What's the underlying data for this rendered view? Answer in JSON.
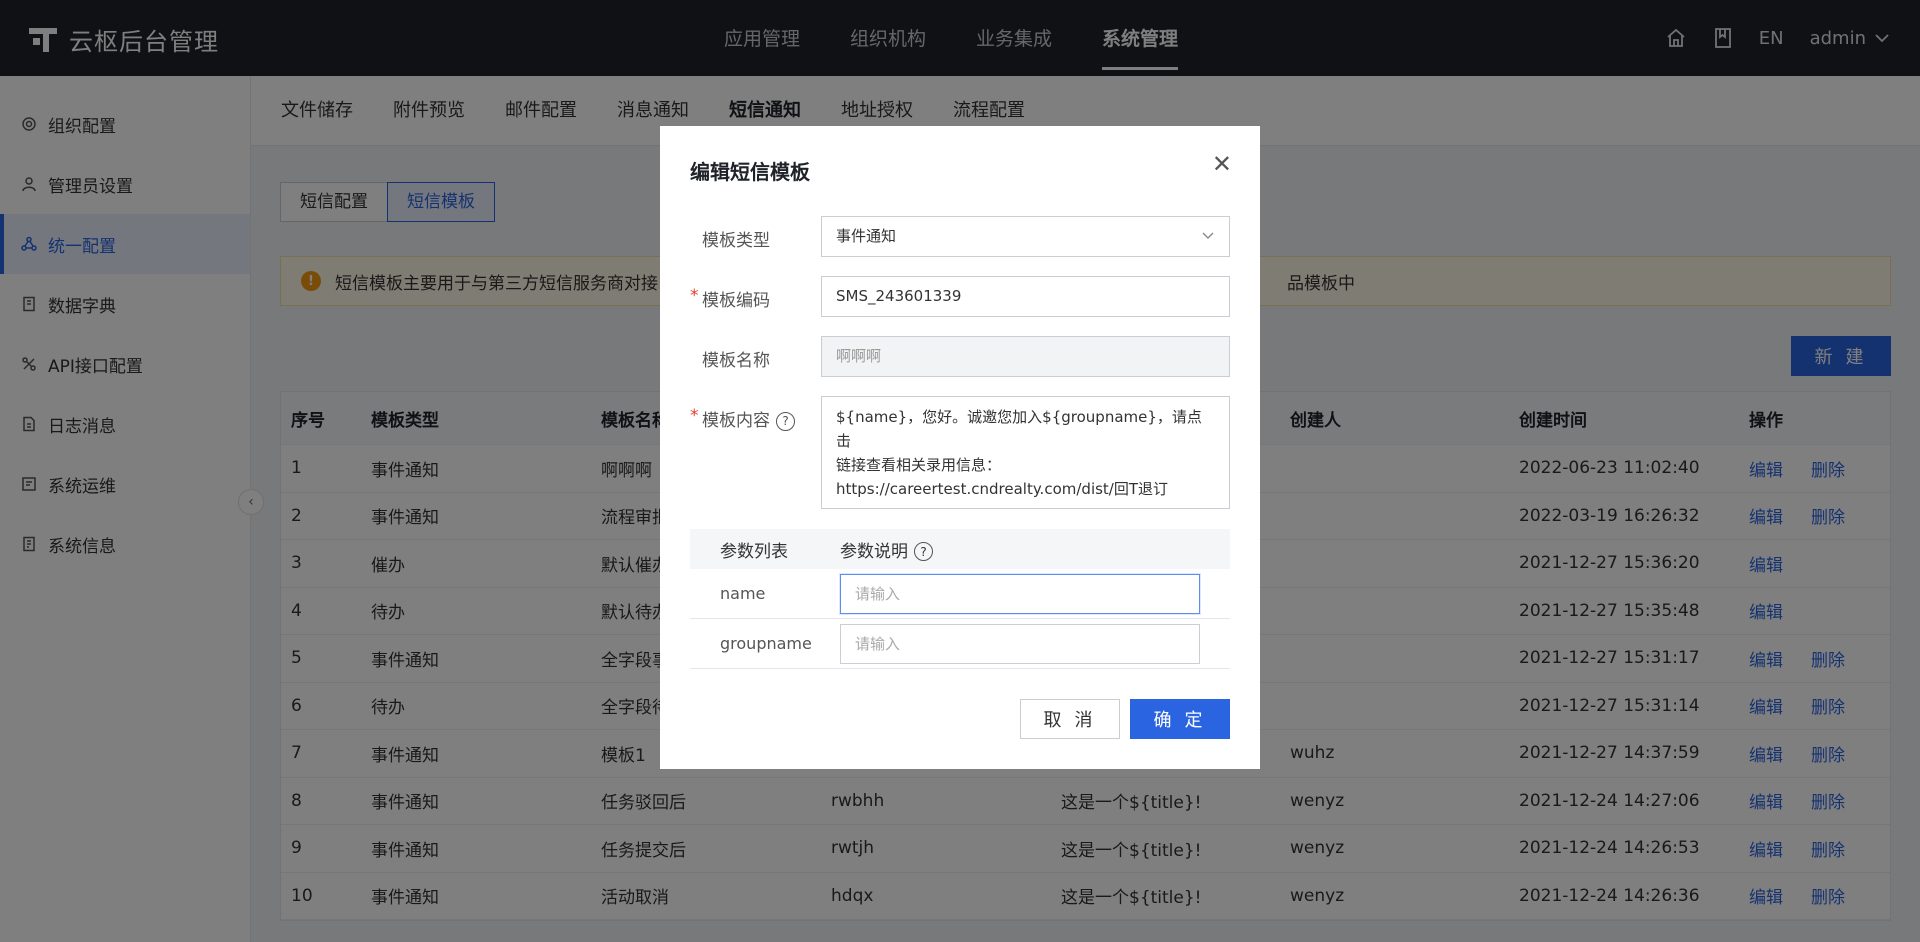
{
  "app": {
    "title": "云枢后台管理"
  },
  "topnav": [
    {
      "label": "应用管理"
    },
    {
      "label": "组织机构"
    },
    {
      "label": "业务集成"
    },
    {
      "label": "系统管理"
    }
  ],
  "topright": {
    "lang": "EN",
    "user": "admin"
  },
  "sidebar": [
    {
      "label": "组织配置",
      "icon": "gear-icon"
    },
    {
      "label": "管理员设置",
      "icon": "user-icon"
    },
    {
      "label": "统一配置",
      "icon": "share-icon"
    },
    {
      "label": "数据字典",
      "icon": "book-icon"
    },
    {
      "label": "API接口配置",
      "icon": "api-icon"
    },
    {
      "label": "日志消息",
      "icon": "document-icon"
    },
    {
      "label": "系统运维",
      "icon": "monitor-icon"
    },
    {
      "label": "系统信息",
      "icon": "info-document-icon"
    }
  ],
  "subtabs": [
    {
      "label": "文件储存"
    },
    {
      "label": "附件预览"
    },
    {
      "label": "邮件配置"
    },
    {
      "label": "消息通知"
    },
    {
      "label": "短信通知"
    },
    {
      "label": "地址授权"
    },
    {
      "label": "流程配置"
    }
  ],
  "segment": {
    "config": "短信配置",
    "template": "短信模板"
  },
  "notice": {
    "text": "短信模板主要用于与第三方短信服务商对接",
    "tail": "品模板中"
  },
  "new_button": "新 建",
  "table": {
    "headers": [
      "序号",
      "模板类型",
      "模板名称",
      "",
      "",
      "创建人",
      "创建时间",
      "操作"
    ],
    "edit_label": "编辑",
    "delete_label": "删除",
    "rows": [
      {
        "no": "1",
        "type": "事件通知",
        "name": "啊啊啊",
        "code": "",
        "content": "",
        "creator": "",
        "time": "2022-06-23 11:02:40",
        "del": "删除"
      },
      {
        "no": "2",
        "type": "事件通知",
        "name": "流程审批",
        "code": "",
        "content": "",
        "creator": "",
        "time": "2022-03-19 16:26:32",
        "del": "删除"
      },
      {
        "no": "3",
        "type": "催办",
        "name": "默认催办",
        "code": "",
        "content": "",
        "creator": "",
        "time": "2021-12-27 15:36:20",
        "del": ""
      },
      {
        "no": "4",
        "type": "待办",
        "name": "默认待办",
        "code": "",
        "content": "",
        "creator": "",
        "time": "2021-12-27 15:35:48",
        "del": ""
      },
      {
        "no": "5",
        "type": "事件通知",
        "name": "全字段事",
        "code": "",
        "content": "",
        "creator": "",
        "time": "2021-12-27 15:31:17",
        "del": "删除"
      },
      {
        "no": "6",
        "type": "待办",
        "name": "全字段待",
        "code": "",
        "content": "",
        "creator": "",
        "time": "2021-12-27 15:31:14",
        "del": "删除"
      },
      {
        "no": "7",
        "type": "事件通知",
        "name": "模板1",
        "code": "",
        "content": "",
        "creator": "wuhz",
        "time": "2021-12-27 14:37:59",
        "del": "删除"
      },
      {
        "no": "8",
        "type": "事件通知",
        "name": "任务驳回后",
        "code": "rwbhh",
        "content": "这是一个${title}!",
        "creator": "wenyz",
        "time": "2021-12-24 14:27:06",
        "del": "删除"
      },
      {
        "no": "9",
        "type": "事件通知",
        "name": "任务提交后",
        "code": "rwtjh",
        "content": "这是一个${title}!",
        "creator": "wenyz",
        "time": "2021-12-24 14:26:53",
        "del": "删除"
      },
      {
        "no": "10",
        "type": "事件通知",
        "name": "活动取消",
        "code": "hdqx",
        "content": "这是一个${title}!",
        "creator": "wenyz",
        "time": "2021-12-24 14:26:36",
        "del": "删除"
      }
    ]
  },
  "modal": {
    "title": "编辑短信模板",
    "fields": {
      "type_label": "模板类型",
      "type_value": "事件通知",
      "code_label": "模板编码",
      "code_value": "SMS_243601339",
      "name_label": "模板名称",
      "name_value": "啊啊啊",
      "content_label": "模板内容",
      "content_lines": [
        "${name}，您好。诚邀您加入${groupname}，请点击",
        "链接查看相关录用信息：",
        "https://careertest.cndrealty.com/dist/回T退订"
      ]
    },
    "params": {
      "col1": "参数列表",
      "col2": "参数说明",
      "rows": [
        {
          "name": "name",
          "placeholder": "请输入"
        },
        {
          "name": "groupname",
          "placeholder": "请输入"
        }
      ]
    },
    "cancel": "取 消",
    "confirm": "确 定"
  },
  "colors": {
    "primary": "#2b64e0",
    "topbar": "#1f2329",
    "warning": "#f29b0f",
    "required": "#e53e31"
  }
}
